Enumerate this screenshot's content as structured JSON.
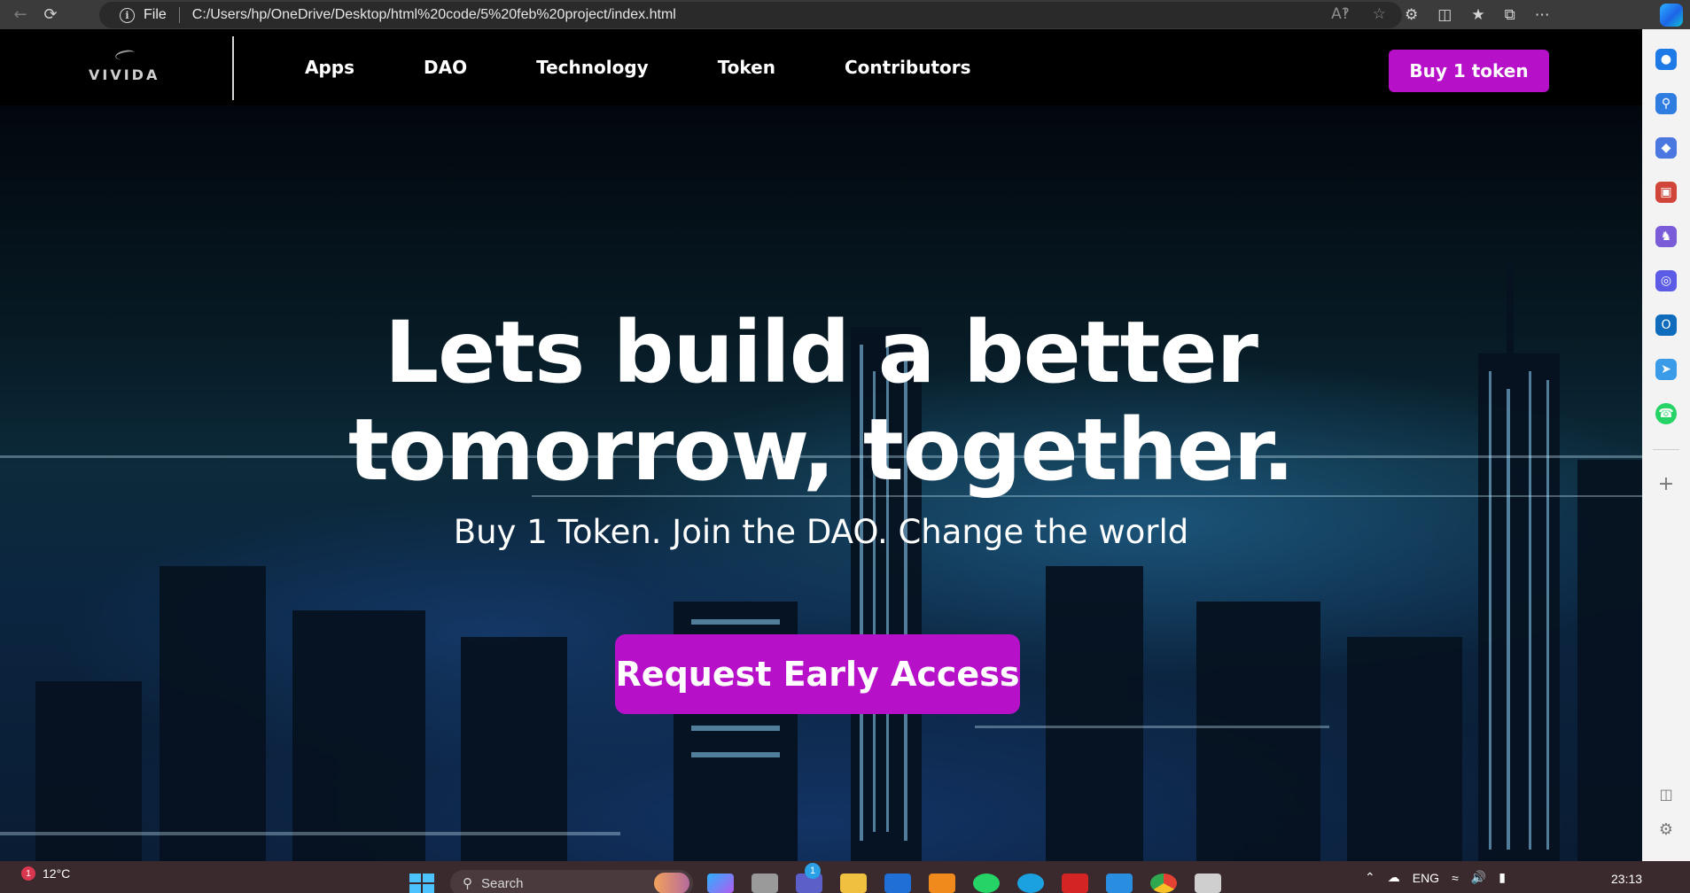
{
  "browser": {
    "file_label": "File",
    "url": "C:/Users/hp/OneDrive/Desktop/html%20code/5%20feb%20project/index.html"
  },
  "site": {
    "logo_text": "VIVIDA",
    "nav": [
      "Apps",
      "DAO",
      "Technology",
      "Token",
      "Contributors"
    ],
    "buy_button": "Buy 1 token"
  },
  "hero": {
    "title_line1": "Lets build a better",
    "title_line2": "tomorrow, together.",
    "subtitle": "Buy 1 Token. Join the DAO. Change the world",
    "cta": "Request Early Access"
  },
  "taskbar": {
    "weather_temp": "12°C",
    "weather_badge": "1",
    "search_placeholder": "Search",
    "teams_badge": "1",
    "language": "ENG",
    "time": "23:13"
  },
  "colors": {
    "accent": "#b611c9",
    "nav_bg": "#000000"
  }
}
